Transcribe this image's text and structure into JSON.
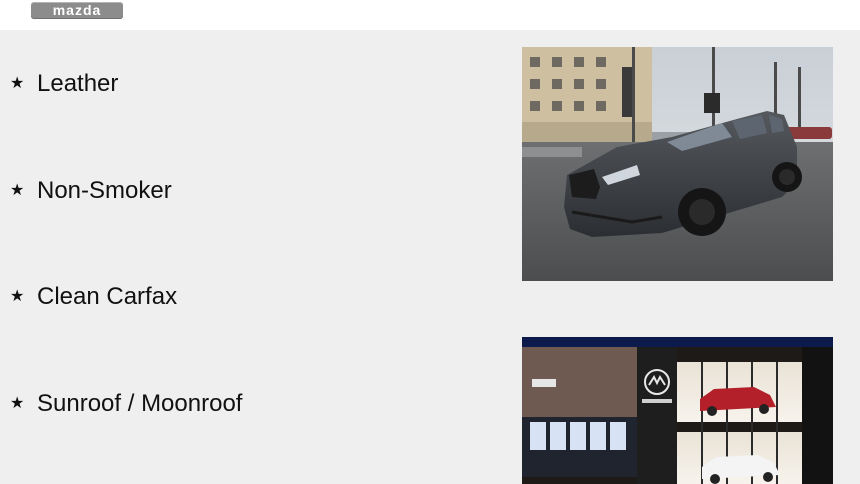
{
  "header": {
    "brand_logo_text": "mazda"
  },
  "features": [
    {
      "label": "Leather",
      "icon": "star-icon"
    },
    {
      "label": "Non-Smoker",
      "icon": "star-icon"
    },
    {
      "label": "Clean Carfax",
      "icon": "star-icon"
    },
    {
      "label": "Sunroof / Moonroof",
      "icon": "star-icon"
    }
  ],
  "photos": [
    {
      "subject": "dark gray SUV in a parking lot"
    },
    {
      "subject": "illuminated dealership building at night"
    }
  ],
  "colors": {
    "background": "#efefef",
    "header": "#ffffff",
    "text": "#111111"
  }
}
